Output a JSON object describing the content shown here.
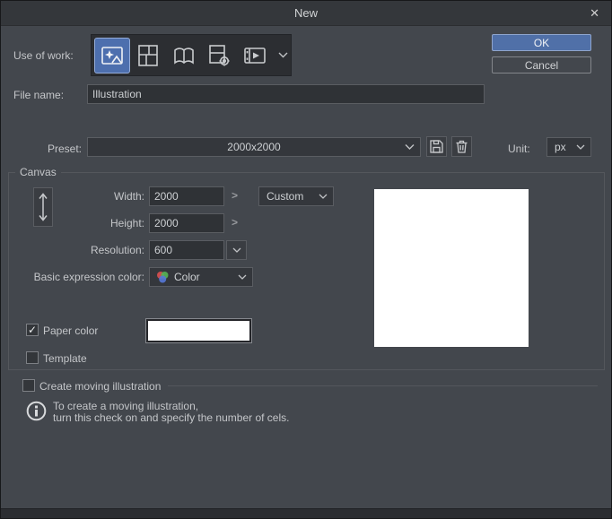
{
  "dialog": {
    "title": "New"
  },
  "icons": {
    "close": "✕",
    "check": "✓",
    "link": ">"
  },
  "actions": {
    "ok": "OK",
    "cancel": "Cancel"
  },
  "use_of_work": {
    "label": "Use of work:",
    "selected": "illustration",
    "options": [
      "illustration",
      "comic",
      "multiple-pages",
      "all-comic-settings",
      "animation"
    ]
  },
  "file_name": {
    "label": "File name:",
    "value": "Illustration"
  },
  "preset": {
    "label": "Preset:",
    "value": "2000x2000"
  },
  "unit": {
    "label": "Unit:",
    "value": "px"
  },
  "canvas": {
    "group_label": "Canvas",
    "width": {
      "label": "Width:",
      "value": "2000"
    },
    "height": {
      "label": "Height:",
      "value": "2000"
    },
    "size_preset": "Custom",
    "resolution": {
      "label": "Resolution:",
      "value": "600"
    },
    "expression": {
      "label": "Basic expression color:",
      "value": "Color"
    },
    "paper_color": {
      "label": "Paper color",
      "checked": true,
      "color": "#ffffff"
    },
    "template": {
      "label": "Template",
      "checked": false
    }
  },
  "moving_illustration": {
    "label": "Create moving illustration",
    "checked": false,
    "info_line1": "To create a moving illustration,",
    "info_line2": "turn this check on and specify the number of cels."
  },
  "colors": {
    "accent": "#4d6fae",
    "paper": "#ffffff"
  }
}
